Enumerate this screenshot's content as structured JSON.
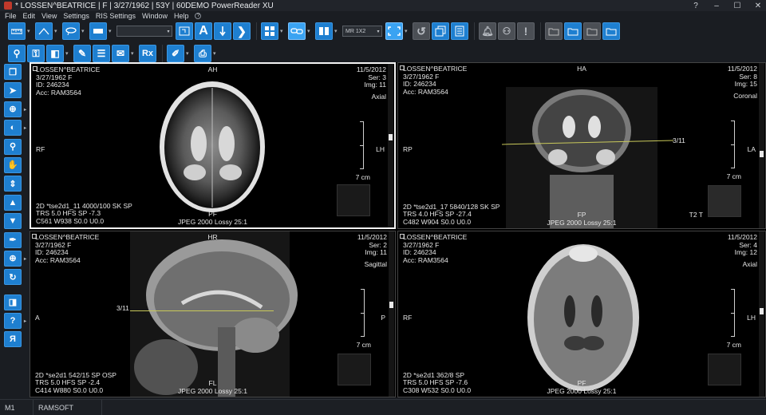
{
  "window": {
    "title": "* LOSSEN^BEATRICE | F | 3/27/1962 | 53Y | 60DEMO PowerReader XU",
    "controls": [
      "?",
      "–",
      "☐",
      "✕"
    ]
  },
  "menu": [
    "File",
    "Edit",
    "View",
    "Settings",
    "RIS Settings",
    "Window",
    "Help"
  ],
  "toolbar1": {
    "series_combo": "",
    "layout_combo": "MR 1X2",
    "buttons": [
      "ruler-icon",
      "angle-icon",
      "freehand-roi-icon",
      "rectangle-icon",
      "open-image-icon",
      "text-annotation-icon",
      "arrow-down-icon",
      "bracket-icon",
      "layout-grid-icon",
      "link-series-icon",
      "book-icon",
      "layout-combo",
      "fit-screen-icon",
      "reset-icon",
      "stack-icon",
      "report-icon",
      "bell-icon",
      "people-icon",
      "alert-icon",
      "folder-icon",
      "folder-send-icon",
      "folder-check-icon",
      "folder-export-icon"
    ]
  },
  "toolbar2": {
    "buttons": [
      "pin-icon",
      "key-image-icon",
      "export-icon",
      "pen-icon",
      "notes-icon",
      "envelope-icon",
      "rx-icon",
      "edit-icon",
      "print-icon"
    ]
  },
  "lefttools": [
    "stack-layers-icon",
    "pointer-icon",
    "zoom-magnify-icon",
    "window-level-icon",
    "zoom-icon",
    "pan-hand-icon",
    "scroll-up-icon",
    "scroll-arrow-up-icon",
    "scroll-arrow-down-icon",
    "cine-icon",
    "crosshair-icon",
    "rotate-icon",
    "invert-icon",
    "question-icon",
    "flip-icon"
  ],
  "viewports": [
    {
      "patient_name": "LOSSEN^BEATRICE",
      "dob_sex": "3/27/1962 F",
      "id": "ID: 246234",
      "acc": "Acc: RAM3564",
      "date": "11/5/2012",
      "series": "Ser: 3",
      "image": "Img: 11",
      "plane": "Axial",
      "orient_top": "AH",
      "orient_bottom": "PF",
      "orient_left": "RF",
      "orient_right": "LH",
      "scale": "7 cm",
      "seq": "2D *tse2d1_11 4000/100 SK SP",
      "trs": "TRS  5.0 HFS SP -7.3",
      "window": "C561 W938 S0.0 U0.0",
      "compression": "JPEG 2000 Lossy 25:1",
      "selected": true
    },
    {
      "patient_name": "LOSSEN^BEATRICE",
      "dob_sex": "3/27/1962 F",
      "id": "ID: 246234",
      "acc": "Acc: RAM3564",
      "date": "11/5/2012",
      "series": "Ser: 8",
      "image": "Img: 15",
      "plane": "Coronal",
      "orient_top": "HA",
      "orient_bottom": "FP",
      "orient_left": "RP",
      "orient_right": "LA",
      "scale": "7 cm",
      "ref": "3/11",
      "extra": "T2 T",
      "seq": "2D *tse2d1_17 5840/128 SK SP",
      "trs": "TRS  4.0 HFS SP -27.4",
      "window": "C482 W904 S0.0 U0.0",
      "compression": "JPEG 2000 Lossy 25:1",
      "selected": false
    },
    {
      "patient_name": "LOSSEN^BEATRICE",
      "dob_sex": "3/27/1962 F",
      "id": "ID: 246234",
      "acc": "Acc: RAM3564",
      "date": "11/5/2012",
      "series": "Ser: 2",
      "image": "Img: 11",
      "plane": "Sagittal",
      "orient_top": "HR",
      "orient_bottom": "FL",
      "orient_left": "A",
      "orient_right": "P",
      "scale": "7 cm",
      "ref": "3/11",
      "seq": "2D *se2d1 542/15 SP OSP",
      "trs": "TRS  5.0 HFS SP -2.4",
      "window": "C414 W880 S0.0 U0.0",
      "compression": "JPEG 2000 Lossy 25:1",
      "selected": false
    },
    {
      "patient_name": "LOSSEN^BEATRICE",
      "dob_sex": "3/27/1962 F",
      "id": "ID: 246234",
      "acc": "Acc: RAM3564",
      "date": "11/5/2012",
      "series": "Ser: 4",
      "image": "Img: 12",
      "plane": "Axial",
      "orient_top": "",
      "orient_bottom": "PF",
      "orient_left": "RF",
      "orient_right": "LH",
      "scale": "7 cm",
      "seq": "2D *se2d1 362/8 SP",
      "trs": "TRS  5.0 HFS SP -7.6",
      "window": "C308 W532 S0.0 U0.0",
      "compression": "JPEG 2000 Lossy 25:1",
      "selected": false
    }
  ],
  "status": {
    "monitor": "M1",
    "user": "RAMSOFT"
  }
}
